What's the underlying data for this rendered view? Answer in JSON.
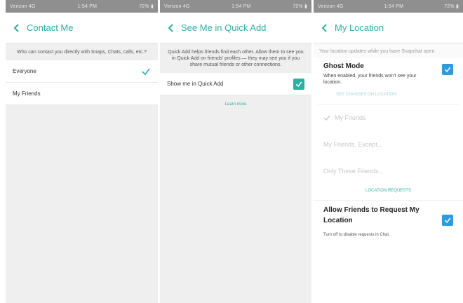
{
  "panel1": {
    "status": {
      "carrier": "Verizon 4G",
      "time": "1:54 PM",
      "battery": "72% ▮"
    },
    "title": "Contact Me",
    "description": "Who can contact you directly with Snaps, Chats, calls, etc.?",
    "options": [
      {
        "label": "Everyone",
        "selected": true
      },
      {
        "label": "My Friends",
        "selected": false
      }
    ]
  },
  "panel2": {
    "status": {
      "carrier": "Verizon 4G",
      "time": "1:54 PM",
      "battery": "72% ▮"
    },
    "title": "See Me in Quick Add",
    "description": "Quick Add helps friends find each other. Allow them to see you in Quick Add on friends' profiles — they may see you if you share mutual friends or other connections.",
    "toggle_label": "Show me in Quick Add",
    "toggle_checked": true,
    "link": "Learn more"
  },
  "panel3": {
    "status": {
      "carrier": "Verizon 4G",
      "time": "1:54 PM",
      "battery": "72% ▮"
    },
    "title": "My Location",
    "description": "Your location updates while you have Snapchat open.",
    "ghost": {
      "title": "Ghost Mode",
      "subtitle": "When enabled, your friends won't see your location.",
      "checked": true,
      "caption": "SEE CHANGES ON LOCATION"
    },
    "options": [
      {
        "label": "My Friends",
        "checked": true
      },
      {
        "label": "My Friends, Except...",
        "checked": false
      },
      {
        "label": "Only These Friends...",
        "checked": false
      }
    ],
    "exceptions": "LOCATION REQUESTS",
    "allow": {
      "title": "Allow Friends to Request My Location",
      "subtitle": "Turn off to disable requests in Chat.",
      "checked": true
    }
  },
  "colors": {
    "accent": "#2ab0a5",
    "checkbox": "#2f9bdb",
    "toggle": "#2ab0a5"
  }
}
